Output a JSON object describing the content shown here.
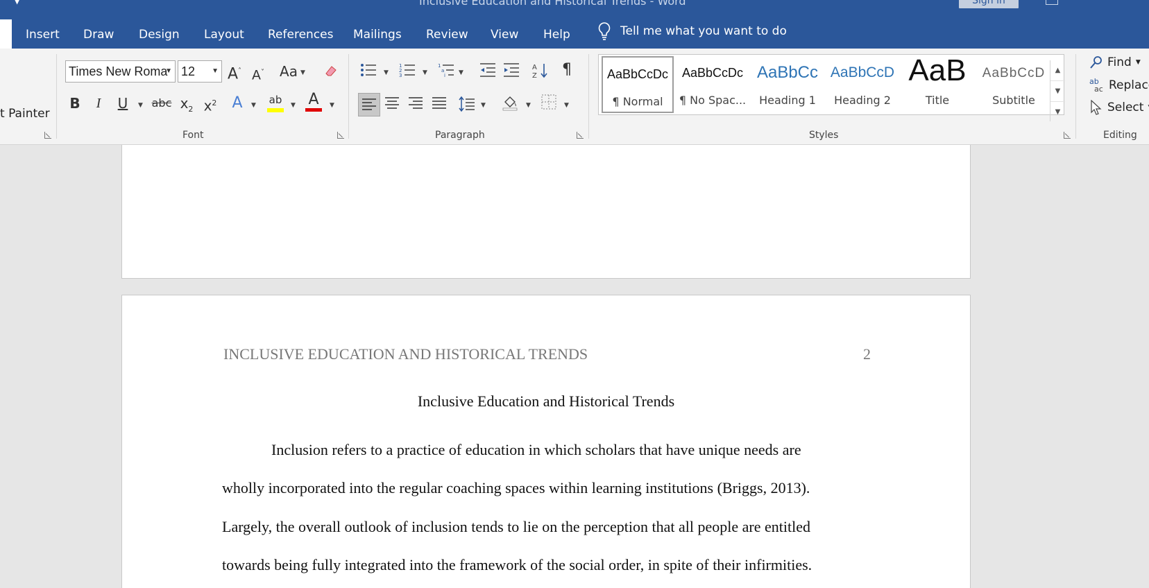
{
  "window": {
    "title": "Inclusive Education and Historical Trends  -  Word",
    "sign_in": "Sign in"
  },
  "tabs": [
    "Insert",
    "Draw",
    "Design",
    "Layout",
    "References",
    "Mailings",
    "Review",
    "View",
    "Help"
  ],
  "tell_me": "Tell me what you want to do",
  "clipboard": {
    "format_painter": "t Painter"
  },
  "font": {
    "group_label": "Font",
    "font_name": "Times New Roma",
    "font_size": "12",
    "grow": "A",
    "shrink": "A",
    "change_case": "Aa",
    "bold": "B",
    "italic": "I",
    "underline": "U",
    "strike": "abc",
    "subscript": "x",
    "sub_mark": "2",
    "superscript": "x",
    "sup_mark": "2",
    "text_effects": "A",
    "highlight": "ab",
    "font_color": "A",
    "highlight_color": "#ffff00",
    "font_color_value": "#e00000"
  },
  "paragraph": {
    "group_label": "Paragraph"
  },
  "styles": {
    "group_label": "Styles",
    "items": [
      {
        "preview": "AaBbCcDc",
        "name": "¶ Normal"
      },
      {
        "preview": "AaBbCcDc",
        "name": "¶ No Spac..."
      },
      {
        "preview": "AaBbCc",
        "name": "Heading 1"
      },
      {
        "preview": "AaBbCcD",
        "name": "Heading 2"
      },
      {
        "preview": "AaB",
        "name": "Title"
      },
      {
        "preview": "AaBbCcD",
        "name": "Subtitle"
      }
    ]
  },
  "editing": {
    "group_label": "Editing",
    "find": "Find",
    "replace": "Replace",
    "replace_icon": "ab",
    "replace_icon2": "ac",
    "select": "Select"
  },
  "document": {
    "header": "INCLUSIVE EDUCATION AND HISTORICAL TRENDS",
    "page_number": "2",
    "title": "Inclusive Education and Historical Trends",
    "lines": [
      "Inclusion refers to a practice of education in which scholars that have unique needs are",
      "wholly incorporated into the regular coaching spaces within learning institutions (Briggs, 2013).",
      "Largely, the overall outlook of inclusion tends to lie on the perception that all people are entitled",
      "towards being fully integrated into the framework of the social order, in spite of their infirmities."
    ]
  }
}
